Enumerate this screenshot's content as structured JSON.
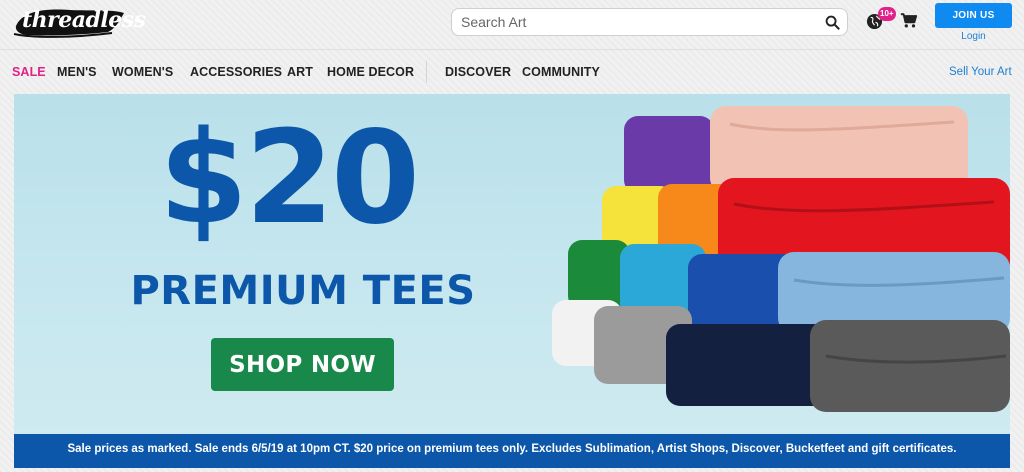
{
  "header": {
    "logo_text": "threadless",
    "search": {
      "placeholder": "Search Art",
      "value": ""
    },
    "notification_badge": "10+",
    "join_label": "JOIN US",
    "login_label": "Login"
  },
  "nav": {
    "items": [
      "SALE",
      "MEN'S",
      "WOMEN'S",
      "ACCESSORIES",
      "ART",
      "HOME DECOR",
      "DISCOVER",
      "COMMUNITY"
    ],
    "sell_label": "Sell Your Art"
  },
  "hero": {
    "price": "$20",
    "headline": "PREMIUM TEES",
    "cta_label": "SHOP NOW",
    "disclaimer": "Sale prices as marked. Sale ends 6/5/19 at 10pm CT. $20 price on premium tees only. Excludes Sublimation, Artist Shops, Discover, Bucketfeet and gift certificates."
  },
  "icons": [
    "search-icon",
    "globe-icon",
    "cart-icon"
  ],
  "colors": {
    "sale_pink": "#e0218a",
    "brand_blue": "#0c57a9",
    "join_blue": "#0f8af0",
    "cta_green": "#18894a",
    "hero_bg": "#c7e7ef"
  }
}
